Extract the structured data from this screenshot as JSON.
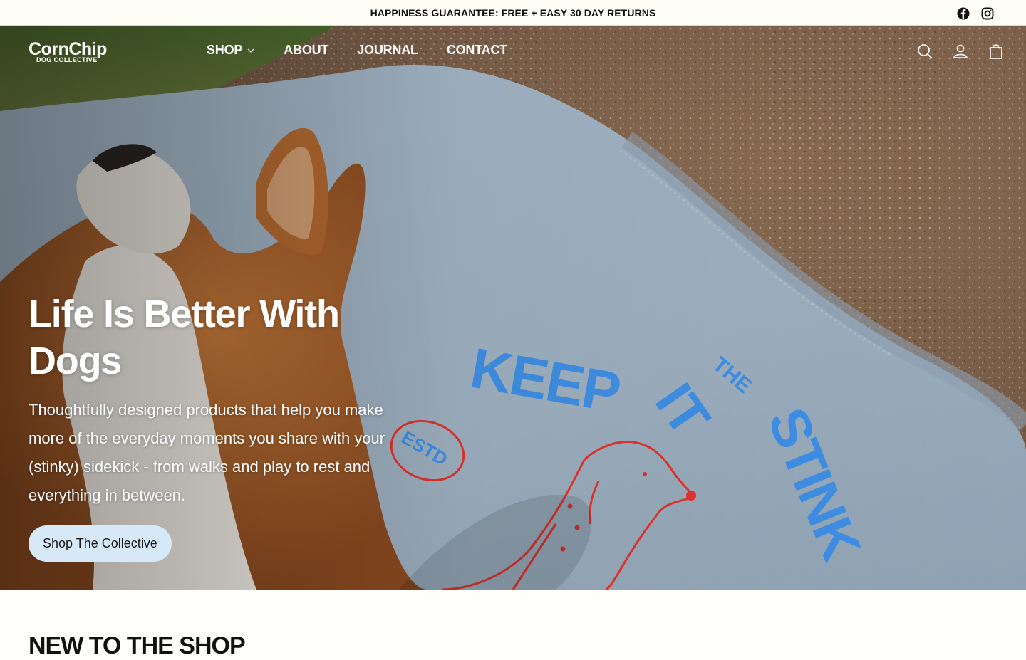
{
  "announcement": {
    "text": "HAPPINESS GUARANTEE: FREE + EASY 30 DAY RETURNS"
  },
  "social": [
    {
      "icon": "facebook-icon"
    },
    {
      "icon": "instagram-icon"
    }
  ],
  "header": {
    "logo_main": "CornChip",
    "logo_sub": "DOG COLLECTIVE",
    "nav": [
      {
        "label": "SHOP",
        "has_dropdown": true
      },
      {
        "label": "ABOUT"
      },
      {
        "label": "JOURNAL"
      },
      {
        "label": "CONTACT"
      }
    ],
    "icons": [
      "search-icon",
      "account-icon",
      "cart-icon"
    ]
  },
  "hero": {
    "title": "Life Is Better With Dogs",
    "subtitle": "Thoughtfully designed products that help you make more of the everyday moments you share with your (stinky) sidekick - from walks and play to rest and everything in between.",
    "button_label": "Shop The Collective",
    "shirt_print": {
      "line1": "KEEP",
      "line2": "IT",
      "line3": "STINK",
      "small": "THE",
      "badge": "ESTD"
    }
  },
  "section": {
    "heading": "NEW TO THE SHOP"
  },
  "colors": {
    "background": "#fefefa",
    "button_bg": "#d7e8f6",
    "shirt_print_blue": "#3f8fe6",
    "shirt_print_red": "#e2332d"
  }
}
